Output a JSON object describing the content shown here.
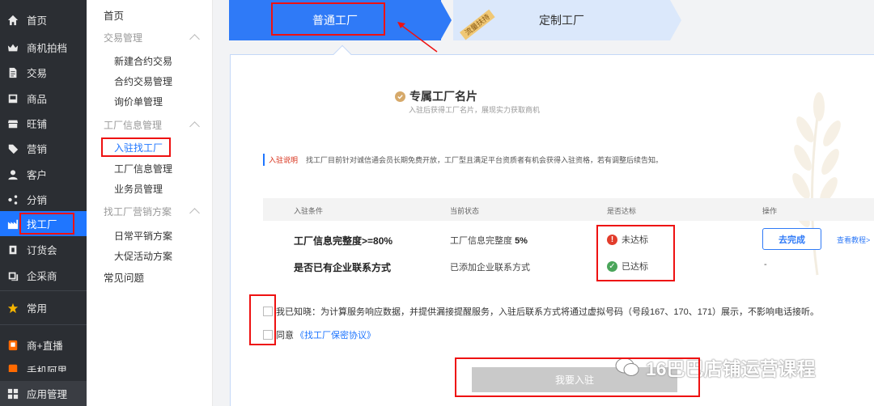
{
  "sidebar": {
    "items": [
      {
        "label": "首页",
        "icon": "home-icon"
      },
      {
        "label": "商机拍档",
        "icon": "crown-icon"
      },
      {
        "label": "交易",
        "icon": "document-icon"
      },
      {
        "label": "商品",
        "icon": "box-icon"
      },
      {
        "label": "旺铺",
        "icon": "store-icon"
      },
      {
        "label": "营销",
        "icon": "tag-icon"
      },
      {
        "label": "客户",
        "icon": "user-icon"
      },
      {
        "label": "分销",
        "icon": "share-icon"
      },
      {
        "label": "找工厂",
        "icon": "factory-icon"
      },
      {
        "label": "订货会",
        "icon": "order-icon"
      },
      {
        "label": "企采商",
        "icon": "purchase-icon"
      },
      {
        "label": "常用",
        "icon": "star-icon"
      },
      {
        "label": "商+直播",
        "icon": "live-icon"
      },
      {
        "label": "手机阿里",
        "icon": "phone-icon"
      }
    ],
    "bottom": {
      "label": "应用管理",
      "icon": "grid-icon"
    }
  },
  "submenu": {
    "home": "首页",
    "group_trade": "交易管理",
    "trade_items": [
      "新建合约交易",
      "合约交易管理",
      "询价单管理"
    ],
    "group_factory": "工厂信息管理",
    "factory_items": [
      "入驻找工厂",
      "工厂信息管理",
      "业务员管理"
    ],
    "group_marketing": "找工厂营销方案",
    "marketing_items": [
      "日常平销方案",
      "大促活动方案"
    ],
    "faq": "常见问题"
  },
  "tabs": {
    "normal": "普通工厂",
    "custom": "定制工厂",
    "ribbon": "流量扶持"
  },
  "card": {
    "title": "专属工厂名片",
    "subtitle": "入驻后获得工厂名片，展现实力获取商机",
    "notice_label": "入驻说明",
    "notice_text": "找工厂目前针对诚信通会员长期免费开放，工厂型且满足平台资质者有机会获得入驻资格，若有调整后续告知。"
  },
  "table": {
    "headers": [
      "入驻条件",
      "当前状态",
      "是否达标",
      "操作"
    ],
    "rows": [
      {
        "condition": "工厂信息完整度>=80%",
        "status_prefix": "工厂信息完整度",
        "status_value": "5%",
        "result": "未达标",
        "action": "去完成",
        "link": "查看教程>"
      },
      {
        "condition": "是否已有企业联系方式",
        "status_prefix": "已添加企业联系方式",
        "status_value": "",
        "result": "已达标",
        "action": "-"
      }
    ]
  },
  "agreements": {
    "notice": "我已知晓：为计算服务响应数据，并提供漏接提醒服务，入驻后联系方式将通过虚拟号码（号段167、170、171）展示，不影响电话接听。",
    "agree_prefix": "同意",
    "agree_link": "《找工厂保密协议》"
  },
  "submit_label": "我要入驻",
  "watermark": "16巴巴店铺运营课程",
  "colors": {
    "primary": "#2f7af7",
    "sidebar": "#2b2e33",
    "error": "#e23c2b",
    "success": "#4aa55a",
    "annotation": "#ee1111"
  }
}
